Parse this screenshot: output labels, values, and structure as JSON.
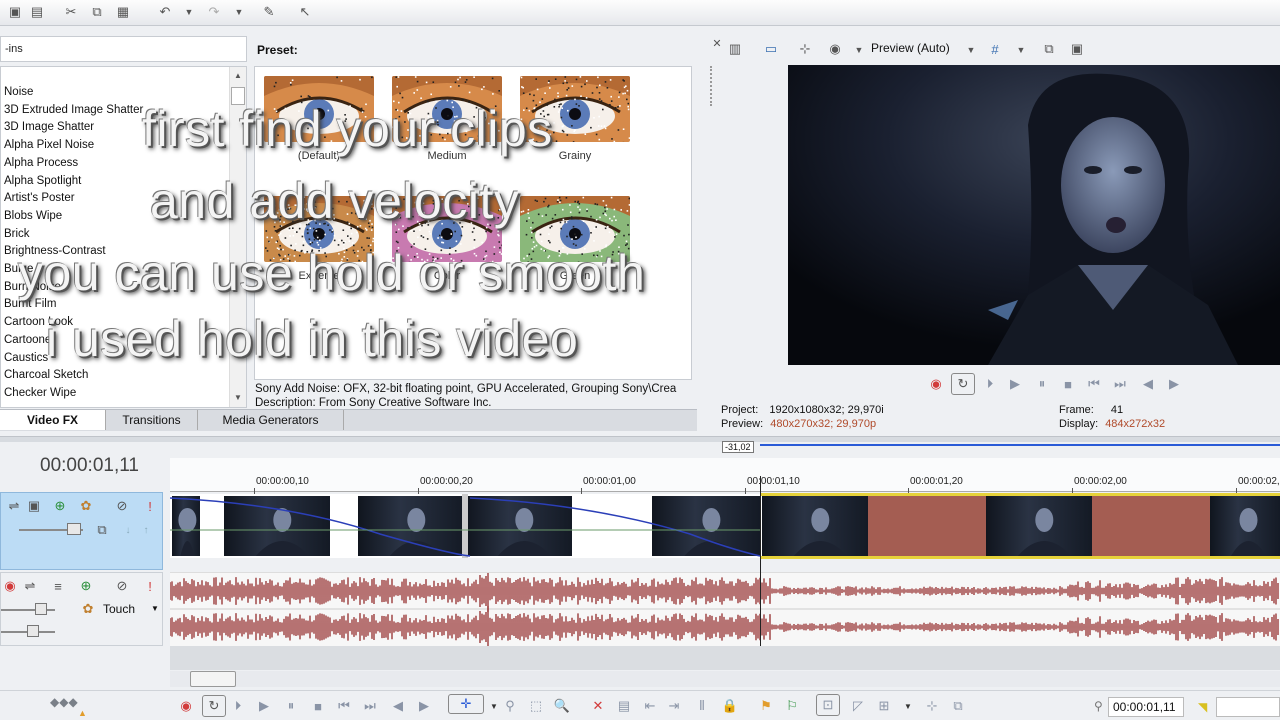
{
  "toolbar": {
    "icons": [
      "save-icon",
      "properties-icon",
      "cut-icon",
      "copy-icon",
      "paste-icon",
      "undo-icon",
      "undo-dropdown-icon",
      "redo-icon",
      "redo-dropdown-icon",
      "render-icon",
      "whats-this-icon"
    ]
  },
  "fx_panel": {
    "search_text": "-ins",
    "items": [
      "Noise",
      "3D Extruded Image Shatter",
      "3D Image Shatter",
      "Alpha Pixel Noise",
      "Alpha Process",
      "Alpha Spotlight",
      "Artist's Poster",
      "Blobs Wipe",
      "Brick",
      "Brightness-Contrast",
      "Bulge",
      "Burn Noise",
      "Burnt Film",
      "Cartoon Look",
      "Cartooner",
      "Caustics",
      "Charcoal Sketch",
      "Checker Wipe"
    ],
    "preset_label": "Preset:",
    "presets": [
      "(Default)",
      "Medium",
      "Grainy",
      "Extreme",
      "Color",
      "Green"
    ],
    "description_line1": "Sony Add Noise: OFX, 32-bit floating point, GPU Accelerated, Grouping Sony\\Crea",
    "description_line2": "Description: From Sony Creative Software Inc.",
    "tabs": [
      "Video FX",
      "Transitions",
      "Media Generators"
    ]
  },
  "overlay_text": {
    "line1": "first find your clips",
    "line2": "and add velocity",
    "line3": "you can use hold or smooth",
    "line4": "i used hold in this video"
  },
  "preview": {
    "mode_label": "Preview (Auto)",
    "project_label": "Project:",
    "project_value": "1920x1080x32; 29,970i",
    "preview_label": "Preview:",
    "preview_value": "480x270x32; 29,970p",
    "frame_label": "Frame:",
    "frame_value": "41",
    "display_label": "Display:",
    "display_value": "484x272x32"
  },
  "timeline": {
    "timecode": "00:00:01,11",
    "marker_label": "-31,02",
    "ruler": [
      "00:00:00,10",
      "00:00:00,20",
      "00:00:01,00",
      "00:00:01,10",
      "00:00:01,20",
      "00:00:02,00",
      "00:00:02,"
    ],
    "audio_mode": "Touch",
    "bottom_timecode": "00:00:01,11"
  },
  "colors": {
    "accent": "#2a5bd7",
    "selected_track": "#bcdcf5",
    "audio_wave": "#9b3a3a",
    "clip_pink": "#a45d52",
    "selected_clip_border": "#e6d23a"
  }
}
